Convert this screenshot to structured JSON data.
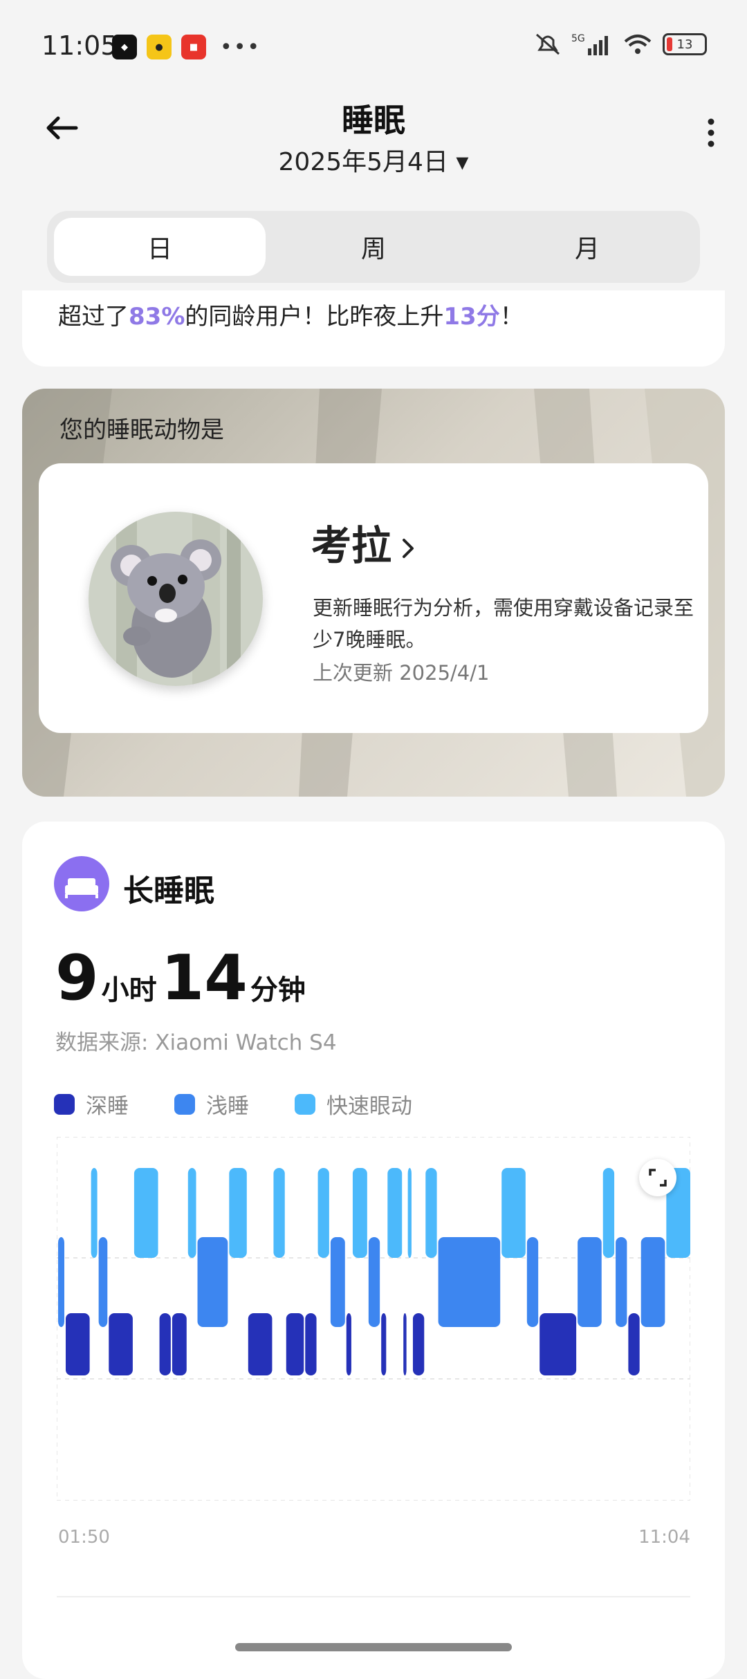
{
  "status": {
    "time": "11:05",
    "battery": "13",
    "net": "5G"
  },
  "header": {
    "title": "睡眠",
    "date": "2025年5月4日 ▾"
  },
  "tabs": [
    {
      "label": "日"
    },
    {
      "label": "周"
    },
    {
      "label": "月"
    }
  ],
  "previous_card": {
    "text_a": "超过了",
    "percent": "83%",
    "text_b": "的同龄用户！比昨夜上升",
    "increase": "13分",
    "text_c": "！"
  },
  "animal": {
    "heading": "您的睡眠动物是",
    "name": "考拉",
    "description": "更新睡眠行为分析，需使用穿戴设备记录至少7晚睡眠。",
    "updated": "上次更新 2025/4/1"
  },
  "sleep": {
    "title": "长睡眠",
    "hours": "9",
    "hours_unit": "小时",
    "minutes": "14",
    "minutes_unit": "分钟",
    "source": "数据来源: Xiaomi Watch S4",
    "legend": [
      {
        "label": "深睡",
        "color": "#2531b8"
      },
      {
        "label": "浅睡",
        "color": "#3d86f0"
      },
      {
        "label": "快速眼动",
        "color": "#4cb9fb"
      }
    ],
    "start": "01:50",
    "end": "11:04"
  },
  "chart_data": {
    "type": "hypnogram",
    "levels": [
      "快速眼动",
      "浅睡",
      "深睡"
    ],
    "x": [
      "01:50",
      "11:04"
    ],
    "segments": [
      [
        0.0,
        0.012,
        "浅睡"
      ],
      [
        0.012,
        0.052,
        "深睡"
      ],
      [
        0.052,
        0.064,
        "快速眼动"
      ],
      [
        0.064,
        0.08,
        "浅睡"
      ],
      [
        0.08,
        0.12,
        "深睡"
      ],
      [
        0.12,
        0.16,
        "快速眼动"
      ],
      [
        0.16,
        0.18,
        "深睡"
      ],
      [
        0.18,
        0.205,
        "深睡"
      ],
      [
        0.205,
        0.22,
        "快速眼动"
      ],
      [
        0.22,
        0.27,
        "浅睡"
      ],
      [
        0.27,
        0.3,
        "快速眼动"
      ],
      [
        0.3,
        0.34,
        "深睡"
      ],
      [
        0.34,
        0.36,
        "快速眼动"
      ],
      [
        0.36,
        0.39,
        "深睡"
      ],
      [
        0.39,
        0.41,
        "深睡"
      ],
      [
        0.41,
        0.43,
        "快速眼动"
      ],
      [
        0.43,
        0.455,
        "浅睡"
      ],
      [
        0.455,
        0.465,
        "深睡"
      ],
      [
        0.465,
        0.49,
        "快速眼动"
      ],
      [
        0.49,
        0.51,
        "浅睡"
      ],
      [
        0.51,
        0.52,
        "深睡"
      ],
      [
        0.52,
        0.545,
        "快速眼动"
      ],
      [
        0.545,
        0.552,
        "深睡"
      ],
      [
        0.552,
        0.56,
        "快速眼动"
      ],
      [
        0.56,
        0.58,
        "深睡"
      ],
      [
        0.58,
        0.6,
        "快速眼动"
      ],
      [
        0.6,
        0.7,
        "浅睡"
      ],
      [
        0.7,
        0.74,
        "快速眼动"
      ],
      [
        0.74,
        0.76,
        "浅睡"
      ],
      [
        0.76,
        0.82,
        "深睡"
      ],
      [
        0.82,
        0.86,
        "浅睡"
      ],
      [
        0.86,
        0.88,
        "快速眼动"
      ],
      [
        0.88,
        0.9,
        "浅睡"
      ],
      [
        0.9,
        0.92,
        "深睡"
      ],
      [
        0.92,
        0.96,
        "浅睡"
      ],
      [
        0.96,
        1.0,
        "快速眼动"
      ]
    ]
  }
}
